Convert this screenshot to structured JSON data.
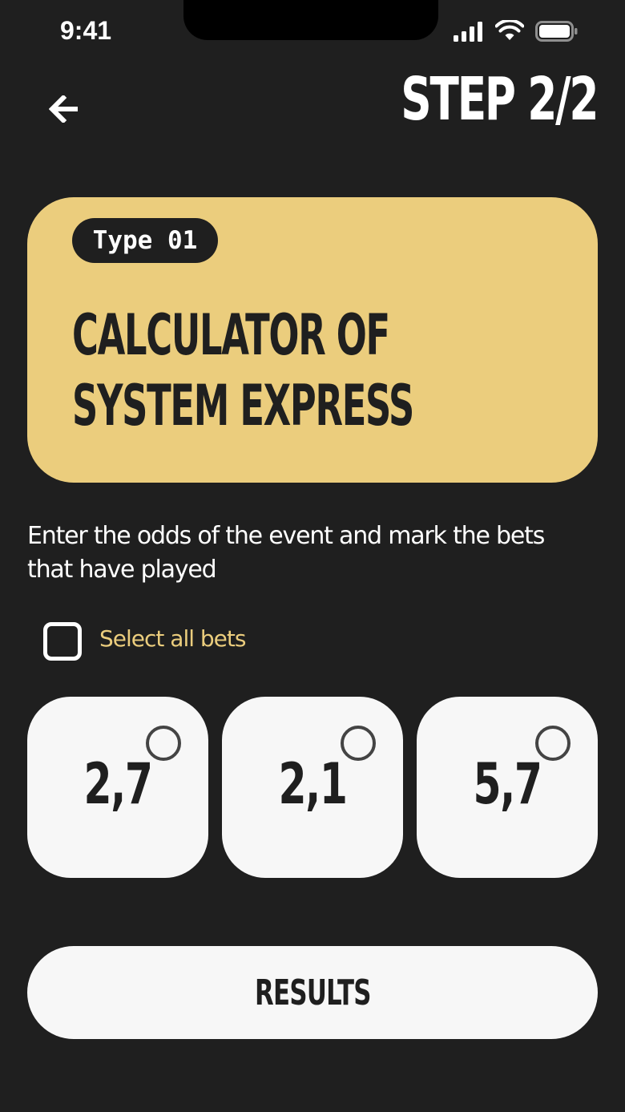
{
  "status_bar": {
    "time": "9:41",
    "icons": [
      "signal-icon",
      "wifi-icon",
      "battery-icon"
    ]
  },
  "header": {
    "back_icon": "arrow-left-icon",
    "step_title": "STEP 2/2"
  },
  "type_card": {
    "badge": "Type 01",
    "title": "CALCULATOR OF SYSTEM EXPRESS",
    "background": "#ebcd7d"
  },
  "instructions": "Enter the odds of the event and mark the bets that have played",
  "select_all": {
    "label": "Select all bets",
    "checked": false
  },
  "odds": [
    {
      "value": "2,7",
      "selected": false
    },
    {
      "value": "2,1",
      "selected": false
    },
    {
      "value": "5,7",
      "selected": false
    }
  ],
  "results_button": {
    "label": "RESULTS"
  },
  "colors": {
    "background": "#1f1f1f",
    "accent": "#ebcd7d",
    "card": "#f7f7f7"
  }
}
